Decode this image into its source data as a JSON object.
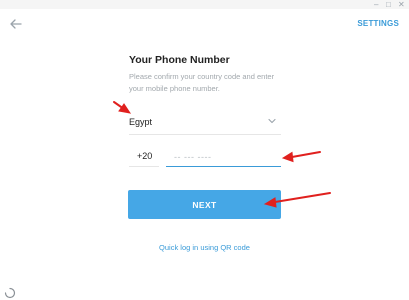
{
  "window": {
    "controls": [
      "–",
      "□",
      "✕"
    ],
    "control_icons": [
      "minimize-icon",
      "maximize-icon",
      "close-icon"
    ]
  },
  "header": {
    "back_icon": "back-arrow-icon",
    "settings_label": "SETTINGS"
  },
  "form": {
    "title": "Your Phone Number",
    "description": "Please confirm your country code and enter your mobile phone number.",
    "country": "Egypt",
    "country_code": "+20",
    "phone_placeholder": "-- --- ----",
    "phone_value": "",
    "next_label": "NEXT",
    "qr_link": "Quick log in using QR code"
  },
  "annotations": {
    "arrow_color": "#e0201e",
    "arrow_count": 3
  },
  "colors": {
    "accent": "#3a9bd8",
    "button": "#45a7e6",
    "text": "#222222",
    "muted": "#a2a8ad"
  }
}
